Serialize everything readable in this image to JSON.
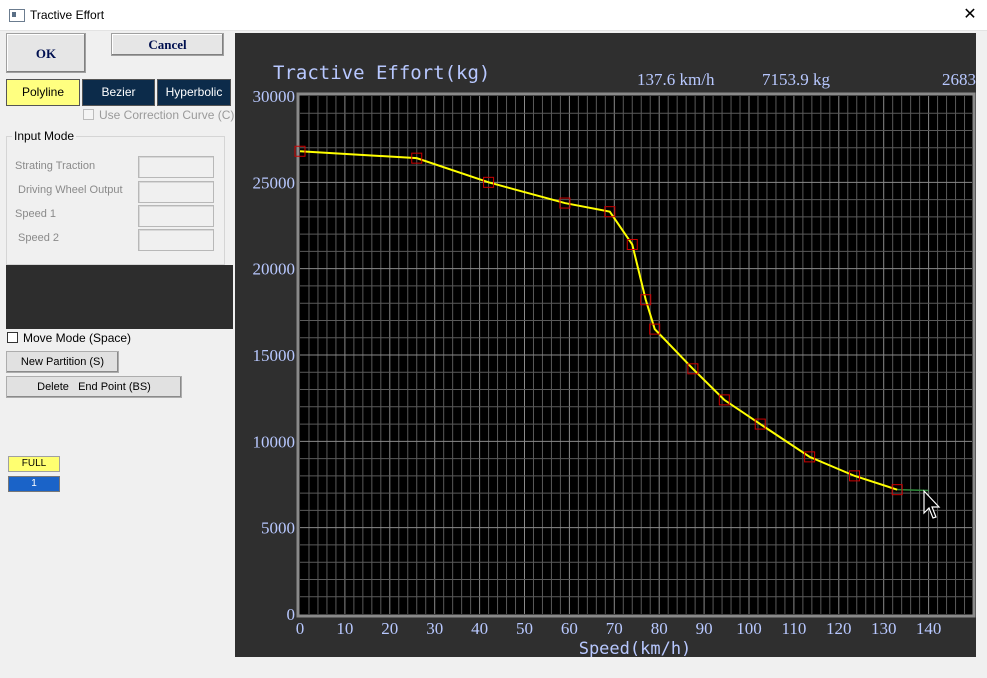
{
  "window": {
    "title": "Tractive Effort",
    "close_glyph": "✕",
    "icon": "app-window-icon"
  },
  "buttons": {
    "ok": "OK",
    "cancel": "Cancel"
  },
  "curve_modes": {
    "polyline": "Polyline",
    "bezier": "Bezier",
    "hyperbolic": "Hyperbolic",
    "selected": "Polyline"
  },
  "use_correction_curve": {
    "label": "Use Correction Curve (C)",
    "checked": false,
    "enabled": false
  },
  "input_mode": {
    "title": "Input Mode",
    "fields": [
      {
        "label": "Strating Traction",
        "value": ""
      },
      {
        "label": "Driving Wheel Output",
        "value": ""
      },
      {
        "label": "Speed 1",
        "value": ""
      },
      {
        "label": "Speed 2",
        "value": ""
      }
    ]
  },
  "move_mode": {
    "label": "Move Mode (Space)",
    "checked": false
  },
  "actions": {
    "new_partition": "New Partition (S)",
    "delete_end_point": "Delete   End Point (BS)"
  },
  "status": {
    "full": "FULL",
    "index": "1"
  },
  "readout": {
    "speed": "137.6 km/h",
    "force": "7153.9 kg",
    "extra": "2683"
  },
  "colors": {
    "chart_bg": "#000000",
    "panel_bg": "#2f2f2f",
    "grid": "#5a5a5a",
    "curve": "#ffff00",
    "marker": "#cc0000",
    "label_text": "#b8c8ff",
    "selected_mode": "#ffff80",
    "mode_button": "#0c2b4a"
  },
  "chart_data": {
    "type": "line",
    "title": "Tractive Effort(kg)",
    "xlabel": "Speed(km/h)",
    "ylabel": "",
    "xlim": [
      0,
      150
    ],
    "ylim": [
      0,
      30000
    ],
    "xticks": [
      0,
      10,
      20,
      30,
      40,
      50,
      60,
      70,
      80,
      90,
      100,
      110,
      120,
      130,
      140
    ],
    "yticks": [
      0,
      5000,
      10000,
      15000,
      20000,
      25000,
      30000
    ],
    "grid": true,
    "series": [
      {
        "x": [
          0,
          26,
          42,
          59,
          69,
          74,
          77,
          79,
          87.5,
          94.5,
          102.5,
          113.5,
          123.5,
          133
        ],
        "y": [
          26800,
          26400,
          25000,
          23800,
          23300,
          21400,
          18200,
          16500,
          14200,
          12400,
          11000,
          9100,
          8000,
          7200
        ]
      }
    ],
    "cursor_segment": {
      "x": [
        133,
        140
      ],
      "y": [
        7200,
        7153.9
      ]
    }
  }
}
